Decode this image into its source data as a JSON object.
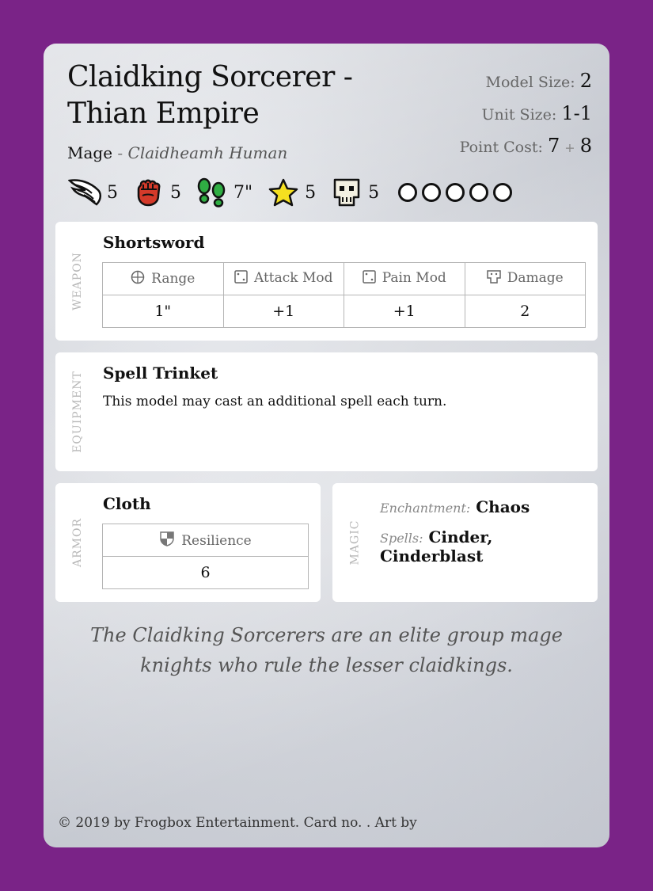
{
  "card": {
    "title": "Claidking Sorcerer - Thian Empire",
    "class": "Mage",
    "separator": "-",
    "race": "Claidheamh Human",
    "model_size_label": "Model Size:",
    "model_size": "2",
    "unit_size_label": "Unit Size:",
    "unit_size": "1-1",
    "point_cost_label": "Point Cost:",
    "point_cost_base": "7",
    "point_cost_plus": "+",
    "point_cost_extra": "8"
  },
  "stats": [
    {
      "icon": "wing-icon",
      "value": "5"
    },
    {
      "icon": "fist-icon",
      "value": "5"
    },
    {
      "icon": "footprints-icon",
      "value": "7\""
    },
    {
      "icon": "star-icon",
      "value": "5"
    },
    {
      "icon": "skull-icon",
      "value": "5"
    }
  ],
  "wound_pips": 5,
  "weapon": {
    "section_label": "Weapon",
    "name": "Shortsword",
    "headers": [
      "Range",
      "Attack Mod",
      "Pain Mod",
      "Damage"
    ],
    "header_icons": [
      "crosshair-icon",
      "die-icon",
      "die-icon",
      "damage-die-icon"
    ],
    "values": [
      "1\"",
      "+1",
      "+1",
      "2"
    ]
  },
  "equipment": {
    "section_label": "Equipment",
    "name": "Spell Trinket",
    "description": "This model may cast an additional spell each turn."
  },
  "armor": {
    "section_label": "Armor",
    "name": "Cloth",
    "header": "Resilience",
    "header_icon": "shield-icon",
    "value": "6"
  },
  "magic": {
    "section_label": "Magic",
    "enchantment_label": "Enchantment:",
    "enchantment": "Chaos",
    "spells_label": "Spells:",
    "spells": "Cinder, Cinderblast"
  },
  "flavor_text": "The Claidking Sorcerers are an elite group mage knights who rule the lesser claidkings.",
  "footer": "© 2019 by Frogbox Entertainment. Card no. . Art by",
  "colors": {
    "background": "#7a2387",
    "fist": "#d43a2a",
    "footprints": "#2fae43",
    "star": "#f5e020"
  }
}
